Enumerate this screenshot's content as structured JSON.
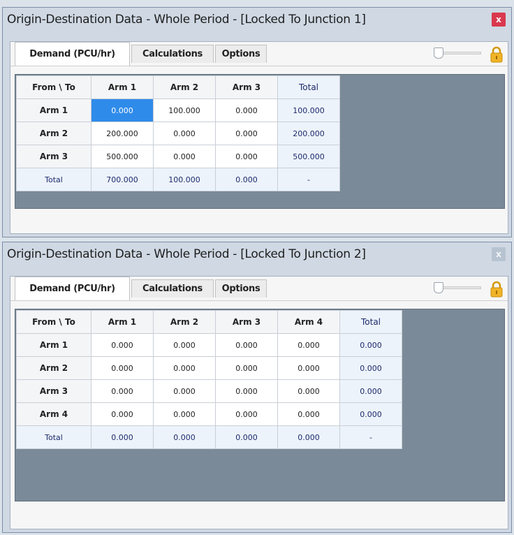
{
  "windows": [
    {
      "title": "Origin-Destination Data - Whole Period - [Locked To Junction 1]",
      "close_label": "x",
      "close_state": "active",
      "tabs": {
        "demand": "Demand (PCU/hr)",
        "calculations": "Calculations",
        "options": "Options"
      },
      "corner": "From \\ To",
      "columns": [
        "Arm 1",
        "Arm 2",
        "Arm 3"
      ],
      "total_label": "Total",
      "rows": [
        {
          "label": "Arm 1",
          "values": [
            "0.000",
            "100.000",
            "0.000"
          ],
          "total": "100.000"
        },
        {
          "label": "Arm 2",
          "values": [
            "200.000",
            "0.000",
            "0.000"
          ],
          "total": "200.000"
        },
        {
          "label": "Arm 3",
          "values": [
            "500.000",
            "0.000",
            "0.000"
          ],
          "total": "500.000"
        }
      ],
      "totals": [
        "700.000",
        "100.000",
        "0.000"
      ],
      "grand_total": "-",
      "selected_cell": "Arm 1 / Arm 1"
    },
    {
      "title": "Origin-Destination Data - Whole Period - [Locked To Junction 2]",
      "close_label": "x",
      "close_state": "inactive",
      "tabs": {
        "demand": "Demand (PCU/hr)",
        "calculations": "Calculations",
        "options": "Options"
      },
      "corner": "From \\ To",
      "columns": [
        "Arm 1",
        "Arm 2",
        "Arm 3",
        "Arm 4"
      ],
      "total_label": "Total",
      "rows": [
        {
          "label": "Arm 1",
          "values": [
            "0.000",
            "0.000",
            "0.000",
            "0.000"
          ],
          "total": "0.000"
        },
        {
          "label": "Arm 2",
          "values": [
            "0.000",
            "0.000",
            "0.000",
            "0.000"
          ],
          "total": "0.000"
        },
        {
          "label": "Arm 3",
          "values": [
            "0.000",
            "0.000",
            "0.000",
            "0.000"
          ],
          "total": "0.000"
        },
        {
          "label": "Arm 4",
          "values": [
            "0.000",
            "0.000",
            "0.000",
            "0.000"
          ],
          "total": "0.000"
        }
      ],
      "totals": [
        "0.000",
        "0.000",
        "0.000",
        "0.000"
      ],
      "grand_total": "-"
    }
  ],
  "colors": {
    "selected_cell": "#2f8bea",
    "close_active": "#d9384e",
    "grid_background": "#7a8a98",
    "lock": "#f0b429"
  },
  "icons": {
    "close": "close-icon",
    "lock": "lock-icon",
    "slider": "zoom-slider"
  }
}
